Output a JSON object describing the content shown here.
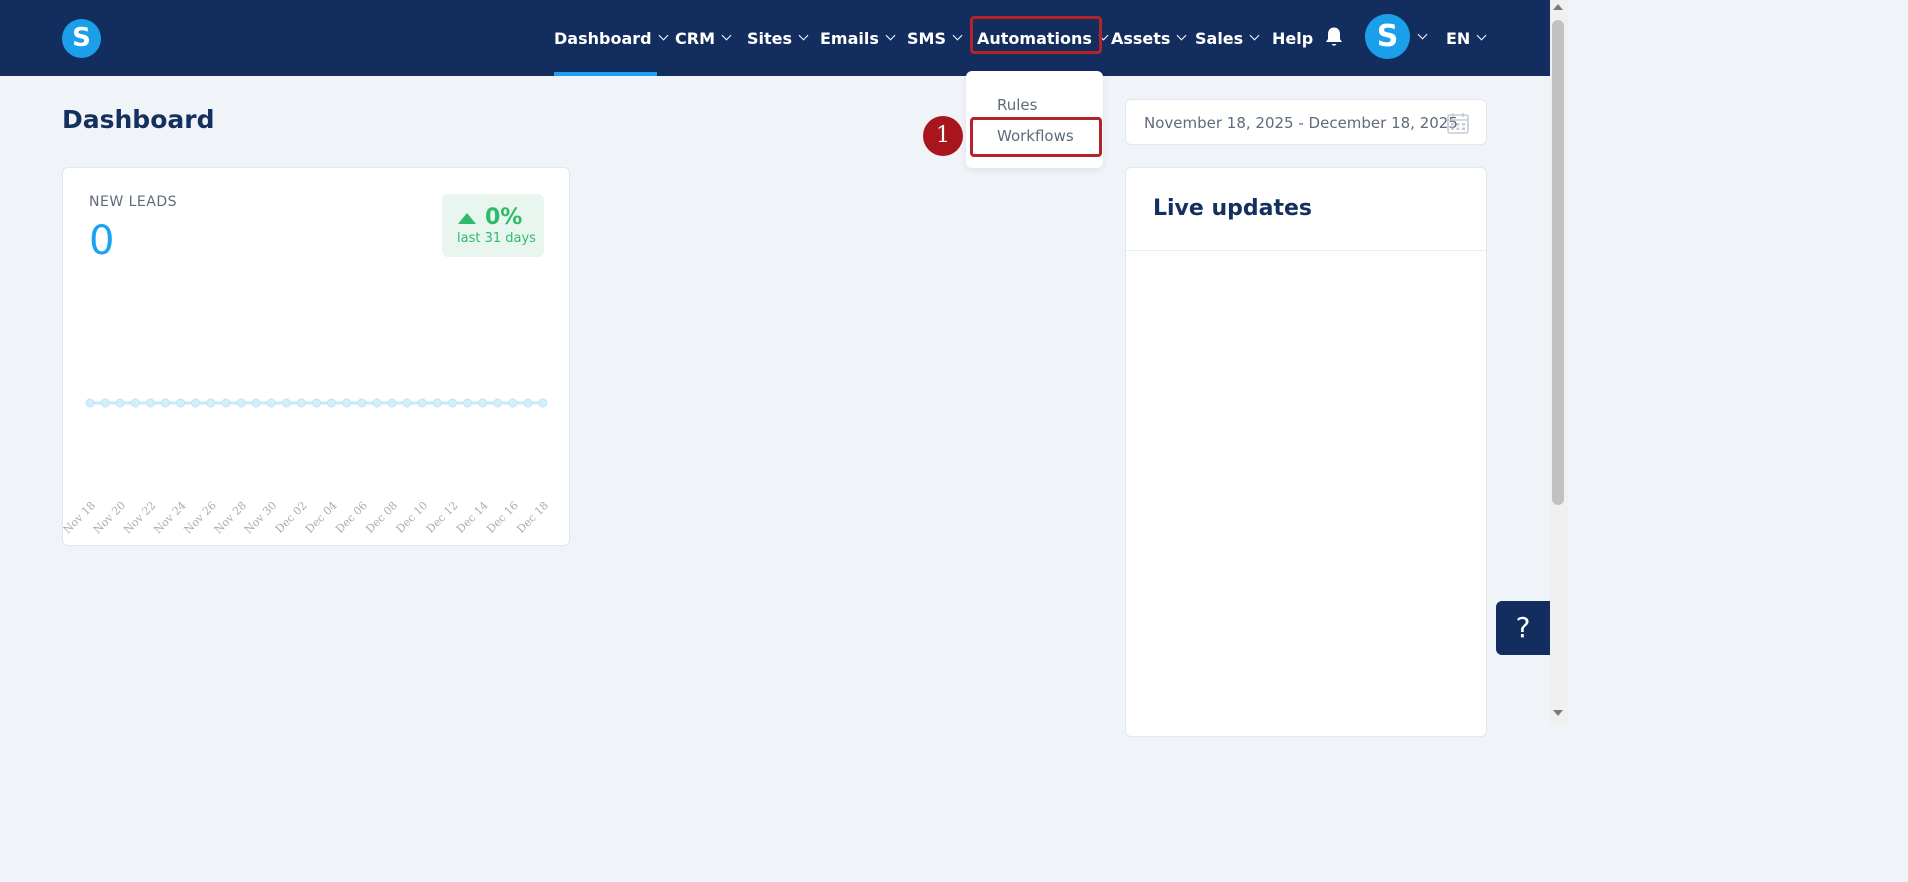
{
  "nav": {
    "logo_letter": "S",
    "items": [
      {
        "label": "Dashboard"
      },
      {
        "label": "CRM"
      },
      {
        "label": "Sites"
      },
      {
        "label": "Emails"
      },
      {
        "label": "SMS"
      },
      {
        "label": "Automations"
      },
      {
        "label": "Assets"
      },
      {
        "label": "Sales"
      },
      {
        "label": "Help"
      }
    ],
    "avatar_letter": "S",
    "language": "EN",
    "bell_icon": "bell-icon"
  },
  "automations_menu": {
    "items": [
      {
        "label": "Rules"
      },
      {
        "label": "Workflows"
      }
    ]
  },
  "annotation": {
    "step": "1"
  },
  "page": {
    "title": "Dashboard",
    "date_range": "November 18, 2025 - December 18, 2025",
    "calendar_icon": "calendar-icon"
  },
  "leads_card": {
    "label": "NEW LEADS",
    "value": "0",
    "trend_pct": "0%",
    "trend_period": "last 31 days"
  },
  "live_updates": {
    "title": "Live updates"
  },
  "help_button": {
    "label": "?"
  },
  "colors": {
    "nav_bg": "#132d5e",
    "accent": "#1da1f2",
    "highlight": "#b4222a",
    "positive": "#2dba6a"
  },
  "chart_data": {
    "type": "line",
    "x": [
      "Nov 18",
      "Nov 19",
      "Nov 20",
      "Nov 21",
      "Nov 22",
      "Nov 23",
      "Nov 24",
      "Nov 25",
      "Nov 26",
      "Nov 27",
      "Nov 28",
      "Nov 29",
      "Nov 30",
      "Dec 01",
      "Dec 02",
      "Dec 03",
      "Dec 04",
      "Dec 05",
      "Dec 06",
      "Dec 07",
      "Dec 08",
      "Dec 09",
      "Dec 10",
      "Dec 11",
      "Dec 12",
      "Dec 13",
      "Dec 14",
      "Dec 15",
      "Dec 16",
      "Dec 17",
      "Dec 18"
    ],
    "tick_labels": [
      "Nov 18",
      "Nov 20",
      "Nov 22",
      "Nov 24",
      "Nov 26",
      "Nov 28",
      "Nov 30",
      "Dec 02",
      "Dec 04",
      "Dec 06",
      "Dec 08",
      "Dec 10",
      "Dec 12",
      "Dec 14",
      "Dec 16",
      "Dec 18"
    ],
    "series": [
      {
        "values": [
          0,
          0,
          0,
          0,
          0,
          0,
          0,
          0,
          0,
          0,
          0,
          0,
          0,
          0,
          0,
          0,
          0,
          0,
          0,
          0,
          0,
          0,
          0,
          0,
          0,
          0,
          0,
          0,
          0,
          0,
          0
        ]
      }
    ],
    "title": "",
    "xlabel": "",
    "ylabel": "",
    "grid": false
  }
}
